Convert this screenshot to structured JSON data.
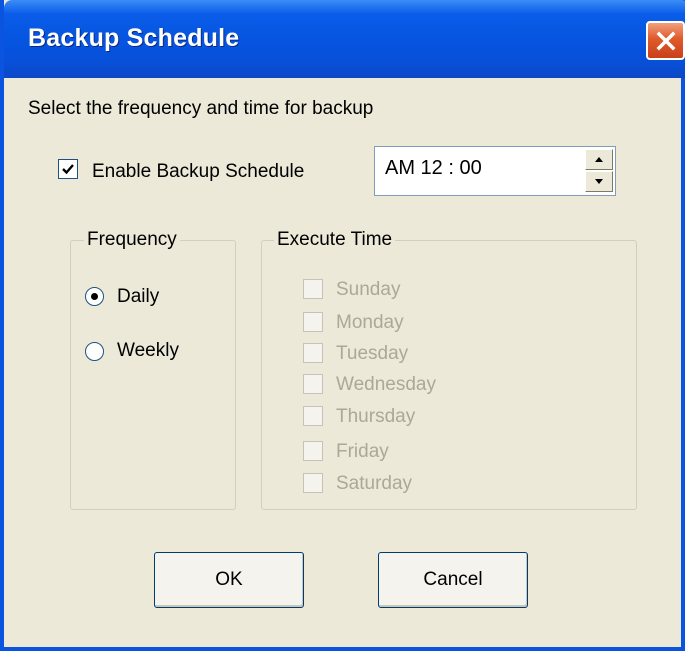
{
  "window": {
    "title": "Backup Schedule",
    "close_icon": "close-icon"
  },
  "prompt": "Select the frequency and time for backup",
  "enable_schedule": {
    "label": "Enable Backup Schedule",
    "checked": true
  },
  "time_spinner": {
    "value": "AM 12 : 00"
  },
  "frequency": {
    "title": "Frequency",
    "options": [
      {
        "label": "Daily",
        "selected": true
      },
      {
        "label": "Weekly",
        "selected": false
      }
    ]
  },
  "execute_time": {
    "title": "Execute Time",
    "days": [
      "Sunday",
      "Monday",
      "Tuesday",
      "Wednesday",
      "Thursday",
      "Friday",
      "Saturday"
    ],
    "enabled": false
  },
  "buttons": {
    "ok": "OK",
    "cancel": "Cancel"
  },
  "colors": {
    "titlebar": "#0654e0",
    "close": "#e05a2a",
    "dialog_bg": "#ece9d8",
    "disabled_text": "#aca899"
  }
}
